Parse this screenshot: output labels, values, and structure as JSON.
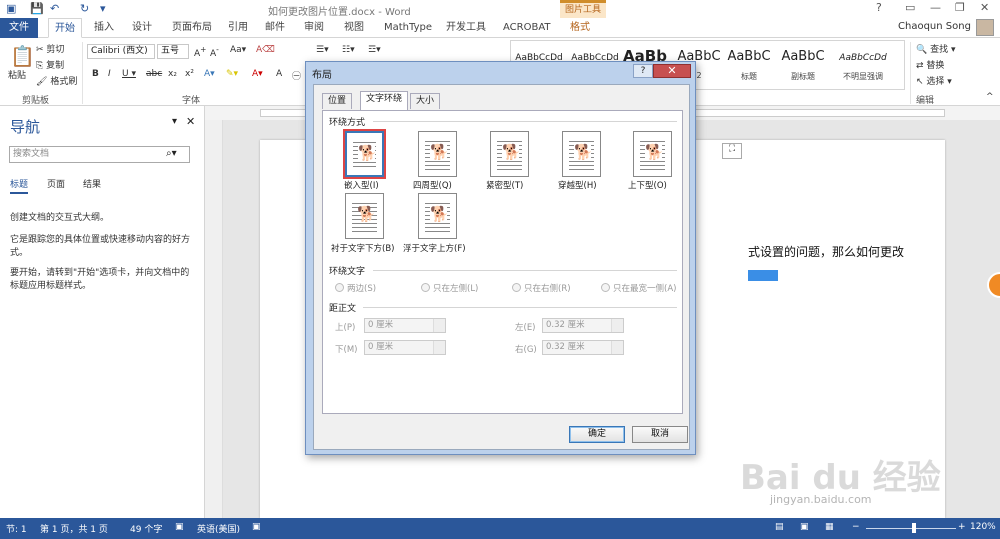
{
  "titlebar": {
    "title": "如何更改图片位置.docx - Word",
    "contextual_group": "图片工具"
  },
  "tabs": {
    "file": "文件",
    "home": "开始",
    "insert": "插入",
    "design": "设计",
    "layout": "页面布局",
    "references": "引用",
    "mailings": "邮件",
    "review": "审阅",
    "view": "视图",
    "mathtype": "MathType",
    "developer": "开发工具",
    "acrobat": "ACROBAT",
    "format": "格式"
  },
  "user": {
    "name": "Chaoqun Song"
  },
  "ribbon": {
    "clipboard": {
      "paste": "粘贴",
      "cut": "剪切",
      "copy": "复制",
      "format_painter": "格式刷",
      "label": "剪贴板"
    },
    "font": {
      "family": "Calibri (西文)",
      "size": "五号",
      "label": "字体"
    },
    "styles": {
      "items": [
        "AaBbCcDd",
        "AaBbCcDd",
        "AaBb",
        "AaBbC",
        "AaBbC",
        "AaBbC",
        "AaBbCcDd"
      ],
      "labels": [
        "",
        "",
        "",
        "2",
        "标题",
        "副标题",
        "不明显强调"
      ]
    },
    "editing": {
      "find": "查找",
      "replace": "替换",
      "select": "选择",
      "label": "编辑"
    }
  },
  "nav": {
    "title": "导航",
    "search_placeholder": "搜索文档",
    "tabs": [
      "标题",
      "页面",
      "结果"
    ],
    "text1": "创建文档的交互式大纲。",
    "text2": "它是跟踪您的具体位置或快速移动内容的好方式。",
    "text3": "要开始，请转到\"开始\"选项卡，并向文档中的标题应用标题样式。"
  },
  "document": {
    "visible_text": "式设置的问题，那么如何更改"
  },
  "dialog": {
    "title": "布局",
    "help": "?",
    "close": "✕",
    "tabs": [
      "位置",
      "文字环绕",
      "大小"
    ],
    "section_wrap_style": "环绕方式",
    "wrap_styles": [
      "嵌入型(I)",
      "四周型(Q)",
      "紧密型(T)",
      "穿越型(H)",
      "上下型(O)",
      "衬于文字下方(B)",
      "浮于文字上方(F)"
    ],
    "section_wrap_text": "环绕文字",
    "wrap_text_options": [
      "两边(S)",
      "只在左侧(L)",
      "只在右侧(R)",
      "只在最宽一侧(A)"
    ],
    "section_distance": "距正文",
    "distance": {
      "top_label": "上(P)",
      "top_value": "0 厘米",
      "bottom_label": "下(M)",
      "bottom_value": "0 厘米",
      "left_label": "左(E)",
      "left_value": "0.32 厘米",
      "right_label": "右(G)",
      "right_value": "0.32 厘米"
    },
    "ok": "确定",
    "cancel": "取消"
  },
  "status": {
    "section": "节: 1",
    "pages": "第 1 页，共 1 页",
    "words": "49 个字",
    "language": "英语(美国)",
    "zoom": "120%"
  },
  "watermark": {
    "brand": "Bai du 经验",
    "url": "jingyan.baidu.com"
  }
}
